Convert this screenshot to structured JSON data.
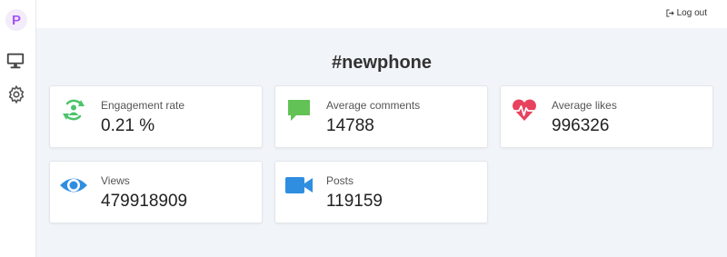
{
  "app": {
    "logo_letter": "P"
  },
  "header": {
    "logout_label": "Log out"
  },
  "page": {
    "title": "#newphone"
  },
  "stats": [
    {
      "label": "Engagement rate",
      "value": "0.21 %",
      "icon": "engagement-icon",
      "color": "#4cc46a"
    },
    {
      "label": "Average comments",
      "value": "14788",
      "icon": "comment-icon",
      "color": "#62c256"
    },
    {
      "label": "Average likes",
      "value": "996326",
      "icon": "heart-pulse-icon",
      "color": "#e8435e"
    },
    {
      "label": "Views",
      "value": "479918909",
      "icon": "eye-icon",
      "color": "#2f8ee0"
    },
    {
      "label": "Posts",
      "value": "119159",
      "icon": "video-camera-icon",
      "color": "#2f8ee0"
    }
  ]
}
